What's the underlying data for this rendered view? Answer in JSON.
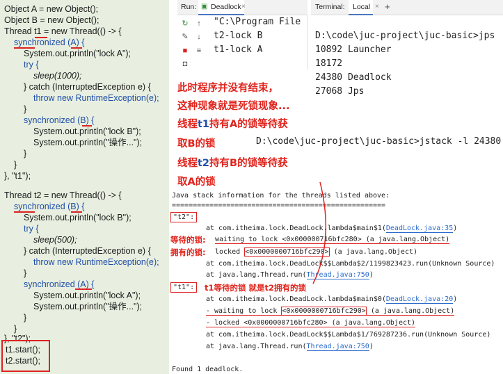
{
  "code": {
    "lines": [
      "Object A = new Object();",
      "Object B = new Object();",
      "Thread t1 = new Thread(() -> {",
      "synchronized (A) {",
      "System.out.println(\"lock A\");",
      "try {",
      "sleep(1000);",
      "} catch (InterruptedException e) {",
      "throw new RuntimeException(e);",
      "}",
      "synchronized (B) {",
      "System.out.println(\"lock B\");",
      "System.out.println(\"操作...\");",
      "}",
      "}",
      "}, \"t1\");",
      "Thread t2 = new Thread(() -> {",
      "synchronized (B) {",
      "System.out.println(\"lock B\");",
      "try {",
      "sleep(500);",
      "} catch (InterruptedException e) {",
      "throw new RuntimeException(e);",
      "}",
      "synchronized (A) {",
      "System.out.println(\"lock A\");",
      "System.out.println(\"操作...\");",
      "}",
      "}",
      "}, \"t2\");",
      "t1.start();",
      "t2.start();"
    ]
  },
  "run": {
    "label": "Run:",
    "tab": "Deadlock",
    "output": [
      "\"C:\\Program File",
      "t2-lock B",
      "t1-lock A"
    ]
  },
  "terminal": {
    "label": "Terminal:",
    "tab": "Local",
    "add": "+",
    "lines": [
      "D:\\code\\juc-project\\juc-basic>jps",
      "10892 Launcher",
      "18172",
      "24380 Deadlock",
      "27068 Jps"
    ]
  },
  "annotation": {
    "l1": "此时程序并没有结束，",
    "l2": "这种现象就是死锁现象...",
    "l3a": "线程",
    "l3b": "t1",
    "l3c": "持有A的锁等待获",
    "l4": "取B的锁",
    "l5a": "线程",
    "l5b": "t2",
    "l5c": "持有B的锁等待获",
    "l6": "取A的锁"
  },
  "jstack_cmd": "D:\\code\\juc-project\\juc-basic>jstack -l 24380",
  "stack": {
    "header": "Java stack information for the threads listed above:",
    "rule": "===================================================",
    "t2": "\"t2\":",
    "t2_l1a": "at com.itheima.lock.DeadLock.lambda$main$1(",
    "t2_l1b": "DeadLock.java:35",
    "t2_l1c": ")",
    "waiting_label": "等待的锁:",
    "t2_l2": "waiting to lock <0x000000716bfc280> (a java.lang.Object)",
    "holding_label": "拥有的锁:",
    "t2_l3a": "locked ",
    "t2_l3b": "<0x0000000716bfc290>",
    "t2_l3c": " (a java.lang.Object)",
    "t2_l4": "at com.itheima.lock.DeadLock$$Lambda$2/1199823423.run(Unknown Source)",
    "t2_l5a": "at java.lang.Thread.run(",
    "t2_l5b": "Thread.java:750",
    "t2_l5c": ")",
    "t1": "\"t1\":",
    "t1_note": "t1等待的锁 就是t2拥有的锁",
    "t1_l1a": "at com.itheima.lock.DeadLock.lambda$main$0(",
    "t1_l1b": "DeadLock.java:20",
    "t1_l1c": ")",
    "t1_l2a": "- waiting to lock ",
    "t1_l2b": "<0x0000000716bfc290>",
    "t1_l2c": " (a java.lang.Object)",
    "t1_l3": "- locked <0x0000000716bfc280> (a java.lang.Object)",
    "t1_l4": "at com.itheima.lock.DeadLock$$Lambda$1/769287236.run(Unknown Source)",
    "t1_l5a": "at java.lang.Thread.run(",
    "t1_l5b": "Thread.java:750",
    "t1_l5c": ")",
    "found": "Found 1 deadlock."
  }
}
